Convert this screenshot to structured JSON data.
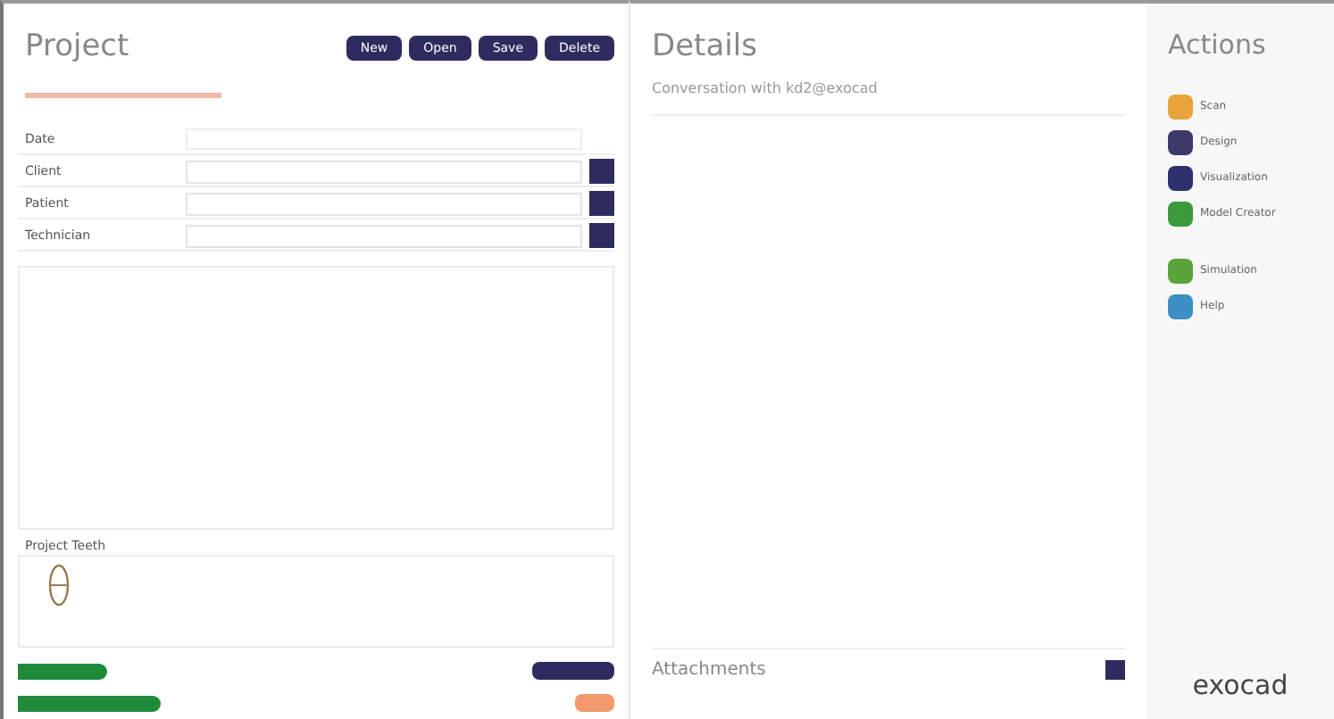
{
  "project": {
    "title": "Project",
    "toolbar": [
      {
        "label": "New"
      },
      {
        "label": "Open"
      },
      {
        "label": "Save"
      },
      {
        "label": "Delete"
      }
    ],
    "fields": [
      {
        "label": "Date",
        "kind": "text"
      },
      {
        "label": "Client",
        "kind": "select"
      },
      {
        "label": "Patient",
        "kind": "select"
      },
      {
        "label": "Technician",
        "kind": "select"
      }
    ],
    "teeth_title": "Project Teeth"
  },
  "details": {
    "title": "Details",
    "subtitle": "Conversation with kd2@exocad",
    "attachments_title": "Attachments"
  },
  "actions": {
    "title": "Actions",
    "items": [
      {
        "label": "Scan",
        "color": "#e8a33a"
      },
      {
        "label": "Design",
        "color": "#3b3a6b"
      },
      {
        "label": "Visualization",
        "color": "#2e2f6e"
      },
      {
        "label": "Model Creator",
        "color": "#3c9a3a"
      },
      {
        "label": "Simulation",
        "color": "#5aa53a"
      },
      {
        "label": "Help",
        "color": "#3b8fc2"
      }
    ]
  },
  "brand": "exocad"
}
